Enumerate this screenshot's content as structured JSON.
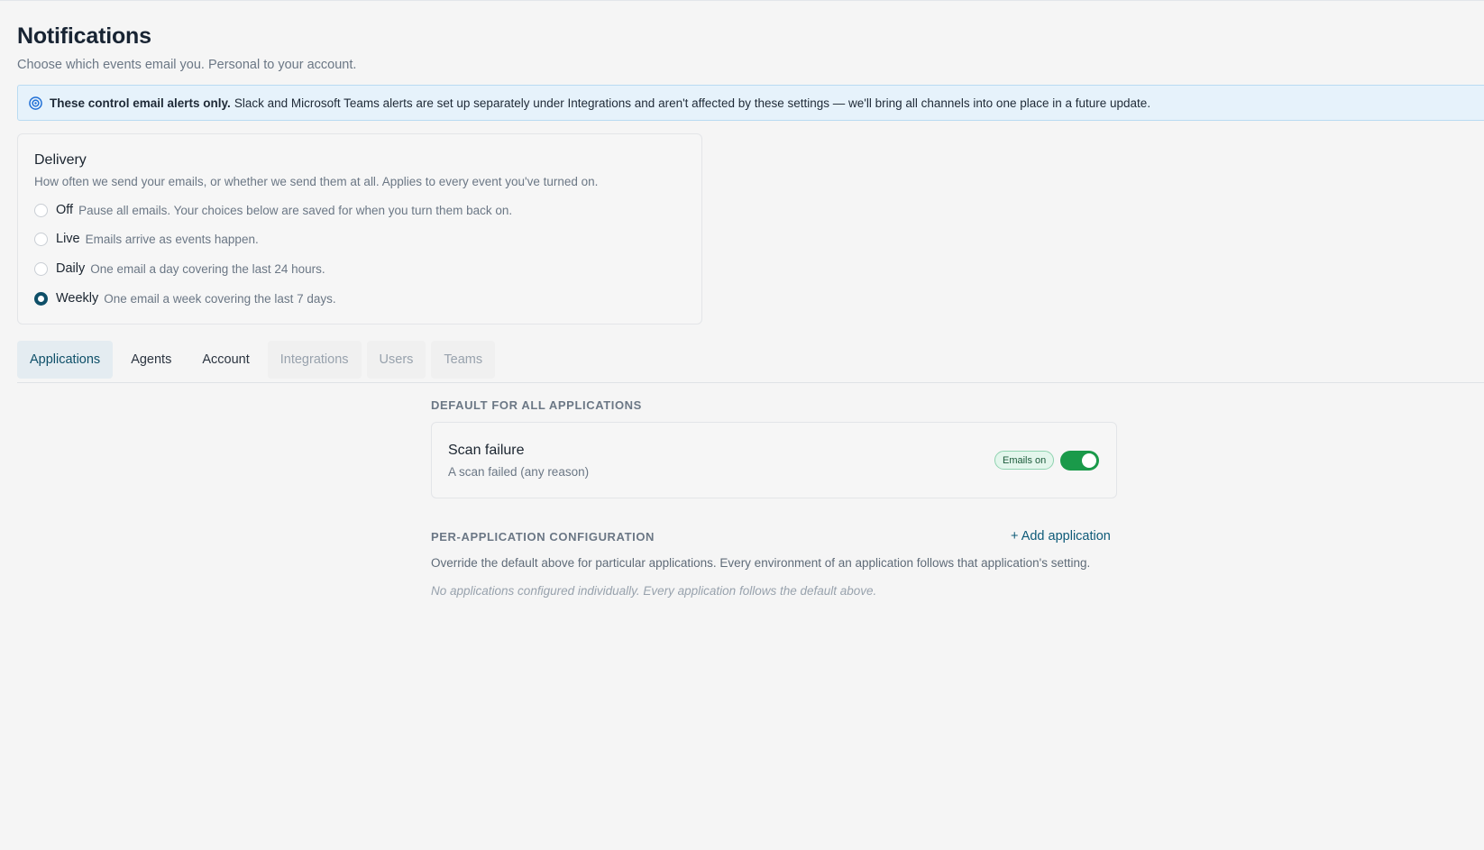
{
  "header": {
    "title": "Notifications",
    "subtitle": "Choose which events email you. Personal to your account."
  },
  "banner": {
    "icon": "info-icon",
    "bold": "These control email alerts only.",
    "text": "Slack and Microsoft Teams alerts are set up separately under Integrations and aren't affected by these settings — we'll bring all channels into one place in a future update."
  },
  "delivery": {
    "title": "Delivery",
    "description": "How often we send your emails, or whether we send them at all. Applies to every event you've turned on.",
    "selected": "Weekly",
    "options": [
      {
        "label": "Off",
        "desc": "Pause all emails. Your choices below are saved for when you turn them back on."
      },
      {
        "label": "Live",
        "desc": "Emails arrive as events happen."
      },
      {
        "label": "Daily",
        "desc": "One email a day covering the last 24 hours."
      },
      {
        "label": "Weekly",
        "desc": "One email a week covering the last 7 days."
      }
    ]
  },
  "tabs": [
    {
      "label": "Applications",
      "state": "active"
    },
    {
      "label": "Agents",
      "state": "normal"
    },
    {
      "label": "Account",
      "state": "normal"
    },
    {
      "label": "Integrations",
      "state": "disabled"
    },
    {
      "label": "Users",
      "state": "disabled"
    },
    {
      "label": "Teams",
      "state": "disabled"
    }
  ],
  "defaults": {
    "heading": "DEFAULT FOR ALL APPLICATIONS",
    "setting": {
      "title": "Scan failure",
      "desc": "A scan failed (any reason)",
      "badge": "Emails on",
      "enabled": true
    }
  },
  "per_app": {
    "heading": "PER-APPLICATION CONFIGURATION",
    "add_label": "+ Add application",
    "description": "Override the default above for particular applications. Every environment of an application follows that application's setting.",
    "empty": "No applications configured individually. Every application follows the default above."
  },
  "colors": {
    "accent": "#0e4f68",
    "toggle_on": "#1a9a4a",
    "banner_bg": "#e6f2fb"
  }
}
